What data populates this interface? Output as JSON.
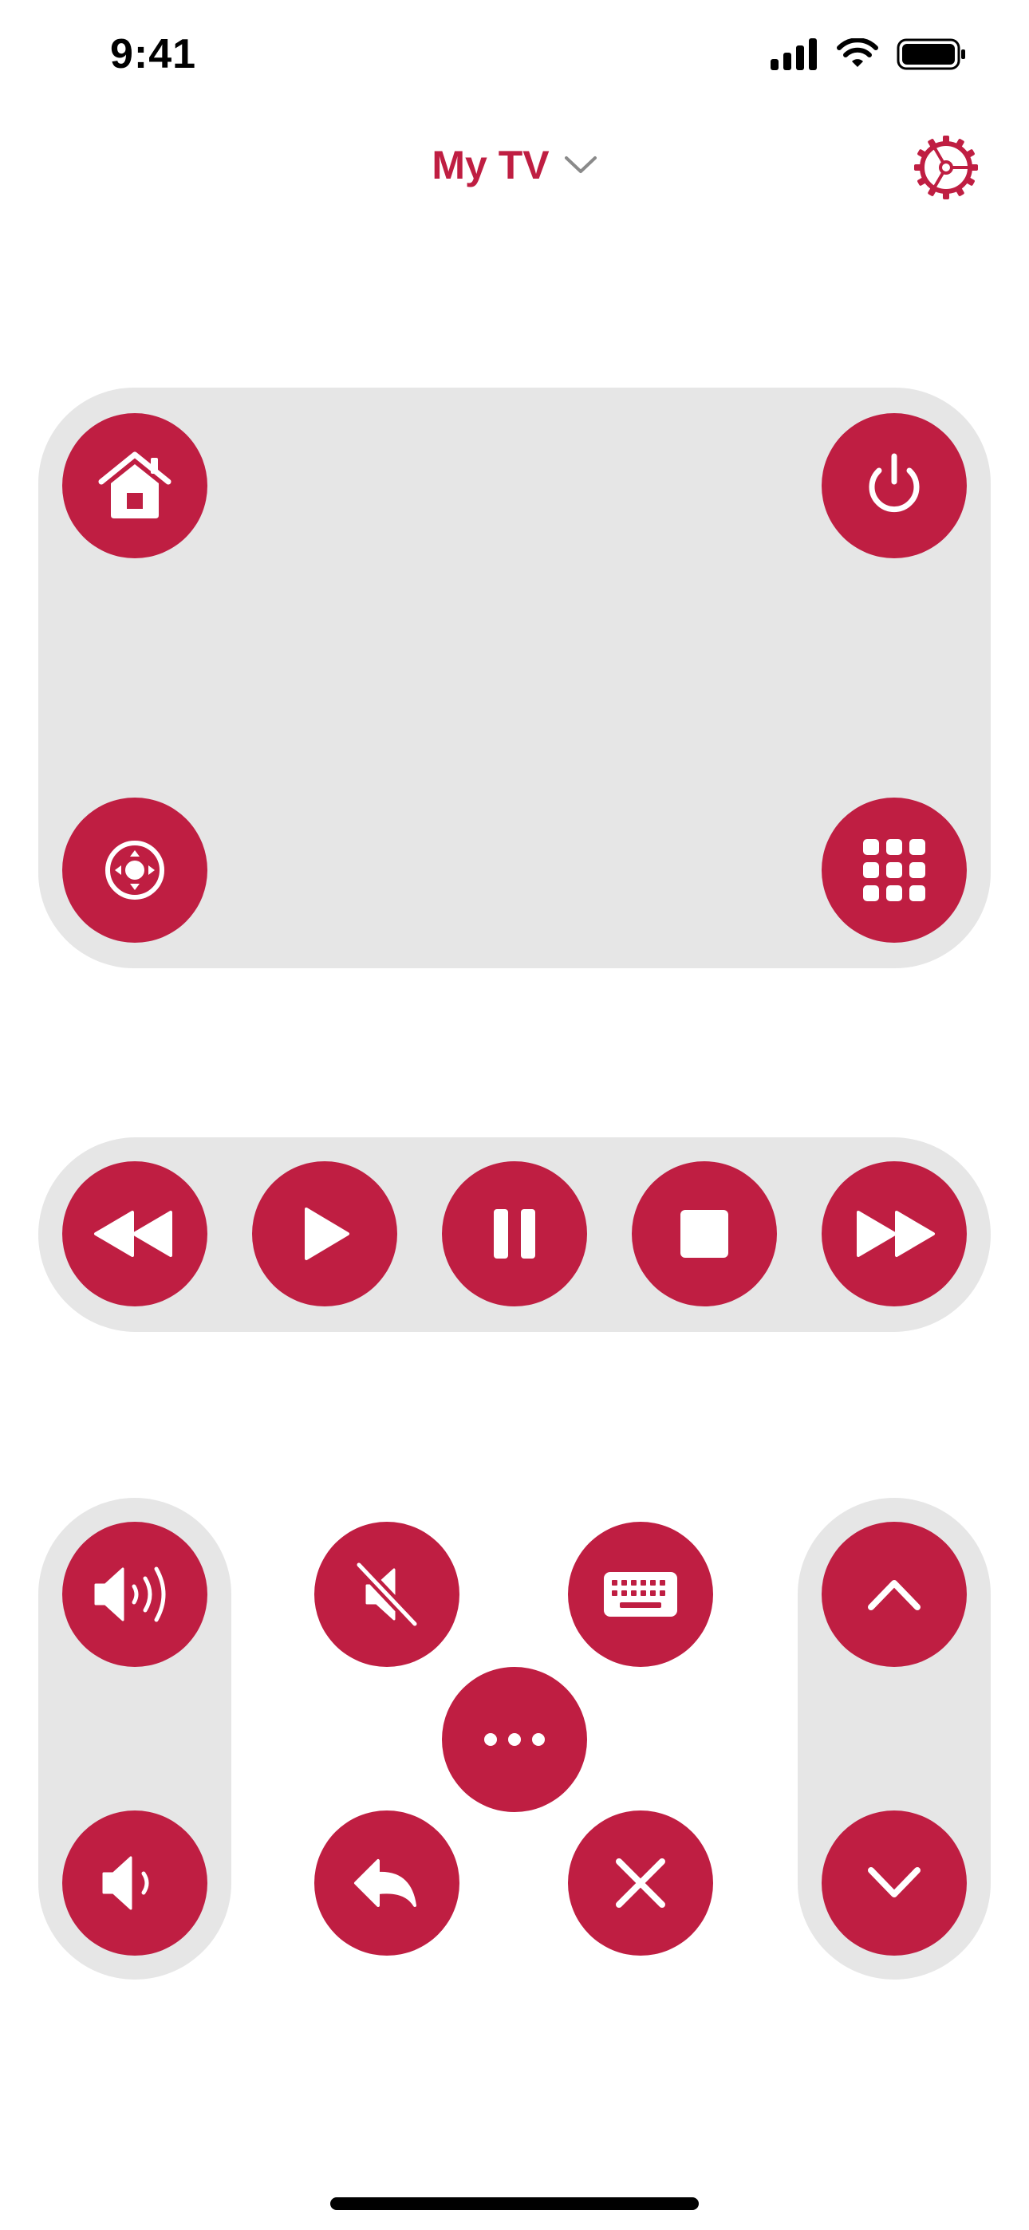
{
  "status_bar": {
    "time": "9:41",
    "icons": [
      "cellular-signal-icon",
      "wifi-icon",
      "battery-icon"
    ]
  },
  "header": {
    "title": "My TV",
    "dropdown_icon": "chevron-down-icon",
    "settings_icon": "gear-icon"
  },
  "colors": {
    "accent": "#bf1e42",
    "panel": "#e6e6e6",
    "background": "#ffffff"
  },
  "touchpad_panel": {
    "buttons": [
      "home-icon",
      "power-icon",
      "dpad-icon",
      "number-grid-icon"
    ]
  },
  "playback_panel": {
    "buttons": [
      "rewind-icon",
      "play-icon",
      "pause-icon",
      "stop-icon",
      "fast-forward-icon"
    ]
  },
  "volume_panel": {
    "buttons": [
      "volume-up-icon",
      "volume-down-icon"
    ]
  },
  "channel_panel": {
    "buttons": [
      "channel-up-icon",
      "channel-down-icon"
    ]
  },
  "center_controls": {
    "buttons": [
      "mute-icon",
      "keyboard-icon",
      "more-icon",
      "back-icon",
      "exit-icon"
    ]
  }
}
